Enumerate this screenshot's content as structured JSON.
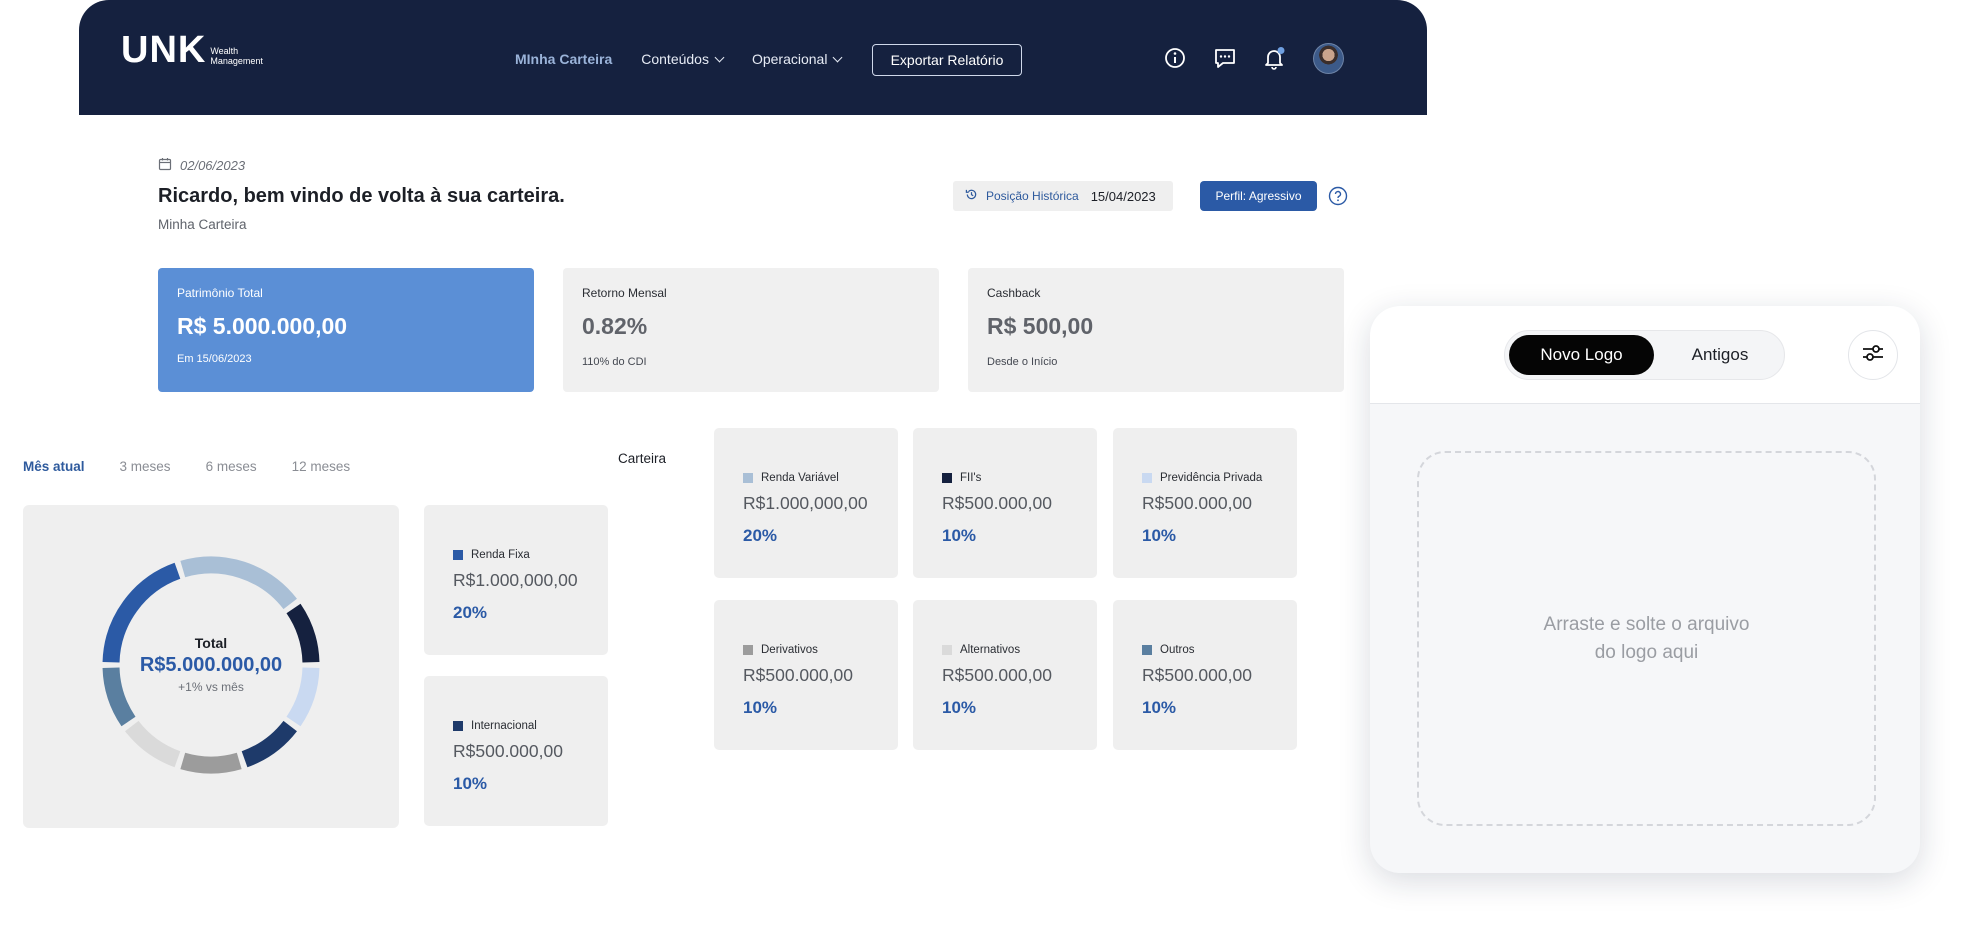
{
  "header": {
    "logo_mark": "UNK",
    "logo_sub_1": "Wealth",
    "logo_sub_2": "Management",
    "nav": [
      {
        "label": "MInha Carteira",
        "active": true
      },
      {
        "label": "Conteúdos",
        "dropdown": true
      },
      {
        "label": "Operacional",
        "dropdown": true
      }
    ],
    "export_label": "Exportar Relatório",
    "icons": [
      "info-icon",
      "chat-icon",
      "bell-icon",
      "avatar"
    ],
    "notification_dot_color": "#6f9fe0",
    "bg_color": "#15213f"
  },
  "greeting": {
    "date": "02/06/2023",
    "title": "Ricardo, bem vindo de volta à sua carteira.",
    "subtitle": "Minha Carteira",
    "history_label": "Posição Histórica",
    "history_date": "15/04/2023",
    "profile_label": "Perfil: Agressivo"
  },
  "stats": [
    {
      "label": "Patrimônio Total",
      "value": "R$ 5.000.000,00",
      "note": "Em 15/06/2023"
    },
    {
      "label": "Retorno Mensal",
      "value": "0.82%",
      "note": "110% do CDI"
    },
    {
      "label": "Cashback",
      "value": "R$ 500,00",
      "note": "Desde o Início"
    }
  ],
  "periods": [
    "Mês atual",
    "3 meses",
    "6 meses",
    "12 meses"
  ],
  "donut": {
    "title": "Total",
    "value": "R$5.000.000,00",
    "note": "+1% vs mês",
    "segments": [
      {
        "color": "#a9bfd6",
        "share": 20
      },
      {
        "color": "#15213f",
        "share": 10
      },
      {
        "color": "#c9d9f1",
        "share": 10
      },
      {
        "color": "#1e3a6a",
        "share": 10
      },
      {
        "color": "#9c9c9c",
        "share": 10
      },
      {
        "color": "#dadada",
        "share": 10
      },
      {
        "color": "#5a7fa0",
        "share": 10
      },
      {
        "color": "#2b5aa6",
        "share": 20
      }
    ]
  },
  "carteira_label": "Carteira",
  "allocations": [
    {
      "name": "Renda Fixa",
      "value": "R$1.000,000,00",
      "pct": "20%",
      "color": "#2b5aa6"
    },
    {
      "name": "Internacional",
      "value": "R$500.000,00",
      "pct": "10%",
      "color": "#1e3a6a"
    },
    {
      "name": "Renda Variável",
      "value": "R$1.000,000,00",
      "pct": "20%",
      "color": "#a9bfd6"
    },
    {
      "name": "FII's",
      "value": "R$500.000,00",
      "pct": "10%",
      "color": "#15213f"
    },
    {
      "name": "Previdência Privada",
      "value": "R$500.000,00",
      "pct": "10%",
      "color": "#c9d9f1"
    },
    {
      "name": "Derivativos",
      "value": "R$500.000,00",
      "pct": "10%",
      "color": "#9c9c9c"
    },
    {
      "name": "Alternativos",
      "value": "R$500.000,00",
      "pct": "10%",
      "color": "#dadada"
    },
    {
      "name": "Outros",
      "value": "R$500.000,00",
      "pct": "10%",
      "color": "#5a7fa0"
    }
  ],
  "logo_panel": {
    "tab_active": "Novo Logo",
    "tab_inactive": "Antigos",
    "dropzone_text_1": "Arraste e solte o arquivo",
    "dropzone_text_2": "do logo aqui"
  }
}
